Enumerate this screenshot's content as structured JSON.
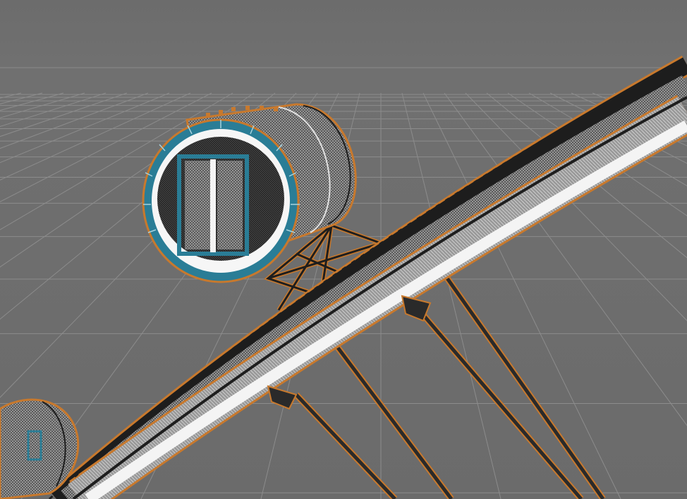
{
  "viewport": {
    "background_color": "#6e6e6e",
    "grid_line_color": "#8c8c8c",
    "horizon_line_color": "#8a8a8a",
    "selection_outline_color": "#c8792d",
    "capsule_rim_color": "#2a7d96",
    "frame_color": "#1e1e1e",
    "wire_color": "#d9d9d9"
  },
  "scene": {
    "objects": [
      {
        "kind": "capsule",
        "icon": "observation-capsule-icon",
        "selected": true
      },
      {
        "kind": "capsule",
        "icon": "observation-capsule-icon",
        "selected": true,
        "partially_visible": true
      },
      {
        "kind": "rim",
        "icon": "ferris-wheel-rim-icon",
        "selected": true
      },
      {
        "kind": "spokes",
        "icon": "support-cable-icon",
        "count": 4
      }
    ]
  }
}
